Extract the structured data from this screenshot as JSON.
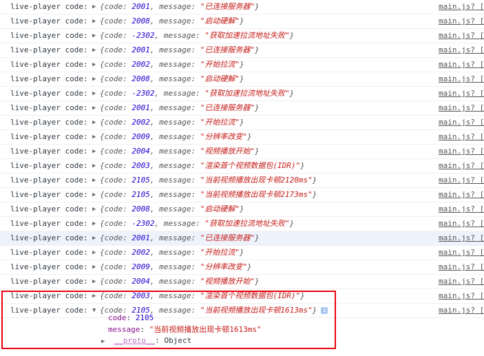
{
  "prefix": "live-player code:",
  "source": "main.js? [",
  "rows": [
    {
      "code": "2001",
      "message": "\"已连接服务器\""
    },
    {
      "code": "2008",
      "message": "\"启动硬解\""
    },
    {
      "code": "-2302",
      "message": "\"获取加速拉流地址失败\""
    },
    {
      "code": "2001",
      "message": "\"已连接服务器\""
    },
    {
      "code": "2002",
      "message": "\"开始拉流\""
    },
    {
      "code": "2008",
      "message": "\"启动硬解\""
    },
    {
      "code": "-2302",
      "message": "\"获取加速拉流地址失败\""
    },
    {
      "code": "2001",
      "message": "\"已连接服务器\""
    },
    {
      "code": "2002",
      "message": "\"开始拉流\""
    },
    {
      "code": "2009",
      "message": "\"分辨率改变\""
    },
    {
      "code": "2004",
      "message": "\"视频播放开始\""
    },
    {
      "code": "2003",
      "message": "\"渲染首个视频数据包(IDR)\""
    },
    {
      "code": "2105",
      "message": "\"当前视频播放出现卡顿2120ms\""
    },
    {
      "code": "2105",
      "message": "\"当前视频播放出现卡顿2173ms\""
    },
    {
      "code": "2008",
      "message": "\"启动硬解\""
    },
    {
      "code": "-2302",
      "message": "\"获取加速拉流地址失败\""
    },
    {
      "code": "2001",
      "message": "\"已连接服务器\""
    },
    {
      "code": "2002",
      "message": "\"开始拉流\""
    },
    {
      "code": "2009",
      "message": "\"分辨率改变\""
    },
    {
      "code": "2004",
      "message": "\"视频播放开始\""
    },
    {
      "code": "2003",
      "message": "\"渲染首个视频数据包(IDR)\""
    },
    {
      "code": "2105",
      "message": "\"当前视频播放出现卡顿1613ms\""
    }
  ],
  "expanded": {
    "code_key": "code",
    "code_value": "2105",
    "message_key": "message",
    "message_value": "\"当前视频播放出现卡顿1613ms\"",
    "proto_key": "__proto__",
    "proto_value": "Object",
    "info": "i"
  },
  "labels": {
    "code": "code: ",
    "message": "message: ",
    "open": "{",
    "close": "}",
    "sep": ", "
  },
  "colors": {
    "highlight_box": "#e8000d",
    "number": "#1c00cf",
    "string": "#c41a16"
  }
}
